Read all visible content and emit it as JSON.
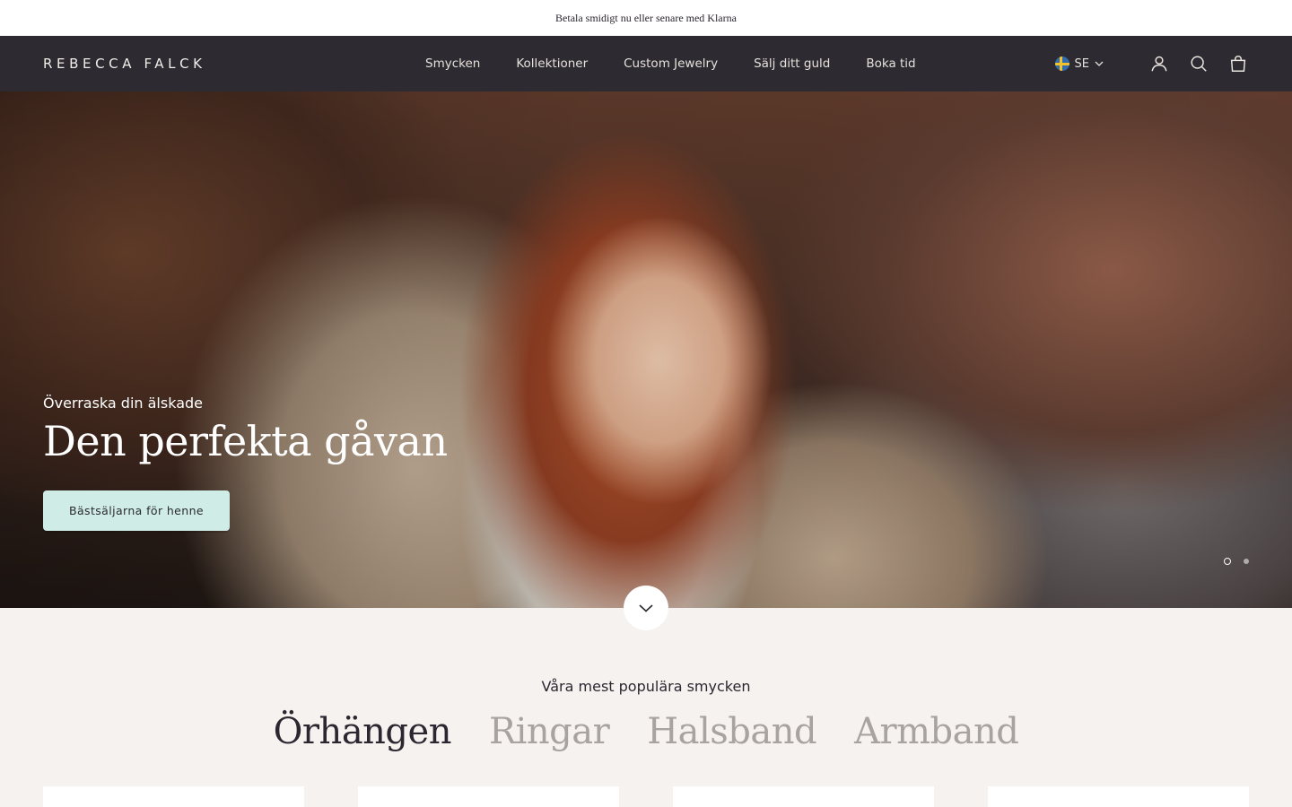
{
  "announcement": {
    "text": "Betala smidigt nu eller senare med Klarna"
  },
  "header": {
    "logo": "REBECCA FALCK",
    "nav": [
      "Smycken",
      "Kollektioner",
      "Custom Jewelry",
      "Sälj ditt guld",
      "Boka tid"
    ],
    "locale": "SE",
    "icons": [
      "swedish-flag-icon",
      "chevron-down-icon",
      "account-icon",
      "search-icon",
      "cart-icon"
    ]
  },
  "hero": {
    "subtitle": "Överraska din älskade",
    "title": "Den perfekta gåvan",
    "button": "Bästsäljarna för henne",
    "slide_count": 2,
    "active_slide": 1
  },
  "popular": {
    "subtitle": "Våra mest populära smycken",
    "tabs": [
      "Örhängen",
      "Ringar",
      "Halsband",
      "Armband"
    ],
    "active_tab": 0
  },
  "colors": {
    "header_bg": "#2d2a31",
    "page_bg": "#f5f2ef",
    "button_bg": "#cfece6",
    "tab_inactive": "#a8a3a0"
  }
}
